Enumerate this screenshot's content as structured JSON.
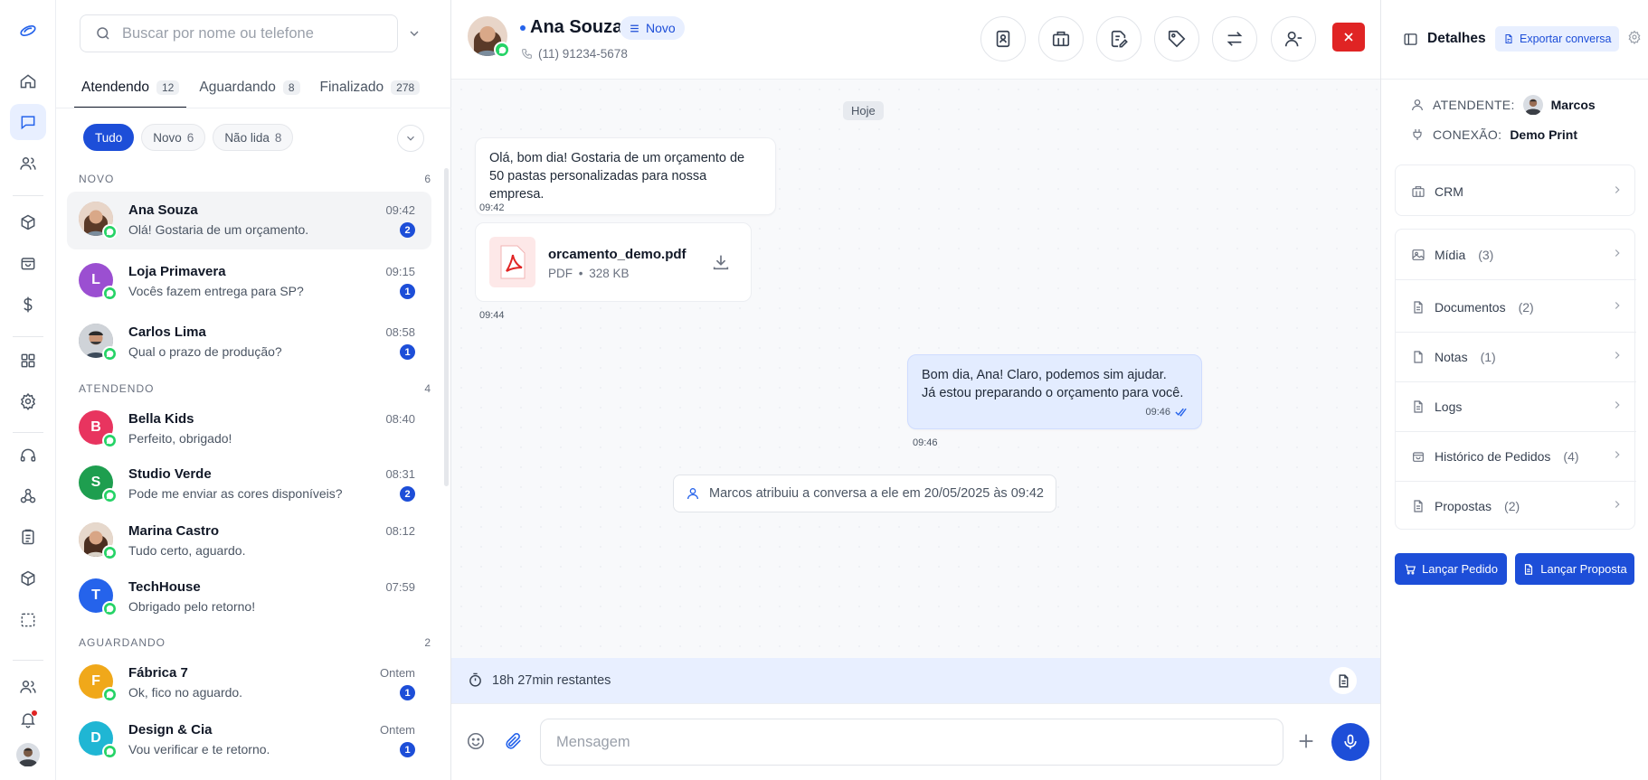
{
  "search": {
    "placeholder": "Buscar por nome ou telefone"
  },
  "tabs": [
    {
      "label": "Atendendo",
      "count": "12"
    },
    {
      "label": "Aguardando",
      "count": "8"
    },
    {
      "label": "Finalizado",
      "count": "278"
    }
  ],
  "filters": [
    {
      "label": "Tudo",
      "count": ""
    },
    {
      "label": "Novo",
      "count": "6"
    },
    {
      "label": "Não lida",
      "count": "8"
    }
  ],
  "sections": {
    "novo": {
      "label": "NOVO",
      "count": "6"
    },
    "atendendo": {
      "label": "ATENDENDO",
      "count": "4"
    },
    "aguardando": {
      "label": "AGUARDANDO",
      "count": "2"
    }
  },
  "conversations": [
    {
      "name": "Ana Souza",
      "preview": "Olá! Gostaria de um orçamento.",
      "time": "09:42",
      "unread": "2",
      "initial": "",
      "color": "#c08a6a"
    },
    {
      "name": "Loja Primavera",
      "preview": "Vocês fazem entrega para SP?",
      "time": "09:15",
      "unread": "1",
      "initial": "L",
      "color": "#9b4fd1"
    },
    {
      "name": "Carlos Lima",
      "preview": "Qual o prazo de produção?",
      "time": "08:58",
      "unread": "1",
      "initial": "",
      "color": "#6b6b6b"
    },
    {
      "name": "Bella Kids",
      "preview": "Perfeito, obrigado!",
      "time": "08:40",
      "unread": "",
      "initial": "B",
      "color": "#e8345f"
    },
    {
      "name": "Studio Verde",
      "preview": "Pode me enviar as cores disponíveis?",
      "time": "08:31",
      "unread": "2",
      "initial": "S",
      "color": "#1e9e4f"
    },
    {
      "name": "Marina Castro",
      "preview": "Tudo certo, aguardo.",
      "time": "08:12",
      "unread": "",
      "initial": "",
      "color": "#b07a5a"
    },
    {
      "name": "TechHouse",
      "preview": "Obrigado pelo retorno!",
      "time": "07:59",
      "unread": "",
      "initial": "T",
      "color": "#2563eb"
    },
    {
      "name": "Fábrica 7",
      "preview": "Ok, fico no aguardo.",
      "time": "Ontem",
      "unread": "1",
      "initial": "F",
      "color": "#f0a81a"
    },
    {
      "name": "Design & Cia",
      "preview": "Vou verificar e te retorno.",
      "time": "Ontem",
      "unread": "1",
      "initial": "D",
      "color": "#1fb6d4"
    }
  ],
  "chat": {
    "contact_name": "Ana Souza",
    "status_badge": "Novo",
    "phone": "(11) 91234-5678",
    "day_label": "Hoje",
    "messages": {
      "in1_line1": "Olá, bom dia! Gostaria de um orçamento de",
      "in1_line2": "50 pastas personalizadas para nossa empresa.",
      "in1_time": "09:42",
      "file_name": "orcamento_demo.pdf",
      "file_type": "PDF",
      "file_size": "328 KB",
      "file_time": "09:44",
      "out1_line1": "Bom dia, Ana! Claro, podemos sim ajudar.",
      "out1_line2": "Já estou preparando o orçamento para você.",
      "out1_time": "09:46",
      "out1_stamp": "09:46"
    },
    "system_message": "Marcos atribuiu a conversa a ele em 20/05/2025 às 09:42",
    "timer": "18h 27min restantes",
    "composer_placeholder": "Mensagem"
  },
  "details": {
    "title": "Detalhes",
    "export_label": "Exportar conversa",
    "attendant_label": "ATENDENTE:",
    "attendant_value": "Marcos",
    "connection_label": "CONEXÃO:",
    "connection_value": "Demo Print",
    "crm_label": "CRM",
    "rows": [
      {
        "label": "Mídia",
        "count": "(3)"
      },
      {
        "label": "Documentos",
        "count": "(2)"
      },
      {
        "label": "Notas",
        "count": "(1)"
      },
      {
        "label": "Logs",
        "count": ""
      },
      {
        "label": "Histórico de Pedidos",
        "count": "(4)"
      },
      {
        "label": "Propostas",
        "count": "(2)"
      }
    ],
    "btn_order": "Lançar Pedido",
    "btn_proposal": "Lançar Proposta"
  },
  "colors": {
    "accent": "#1d4ed8",
    "danger": "#e02424",
    "whatsapp": "#25d366"
  }
}
